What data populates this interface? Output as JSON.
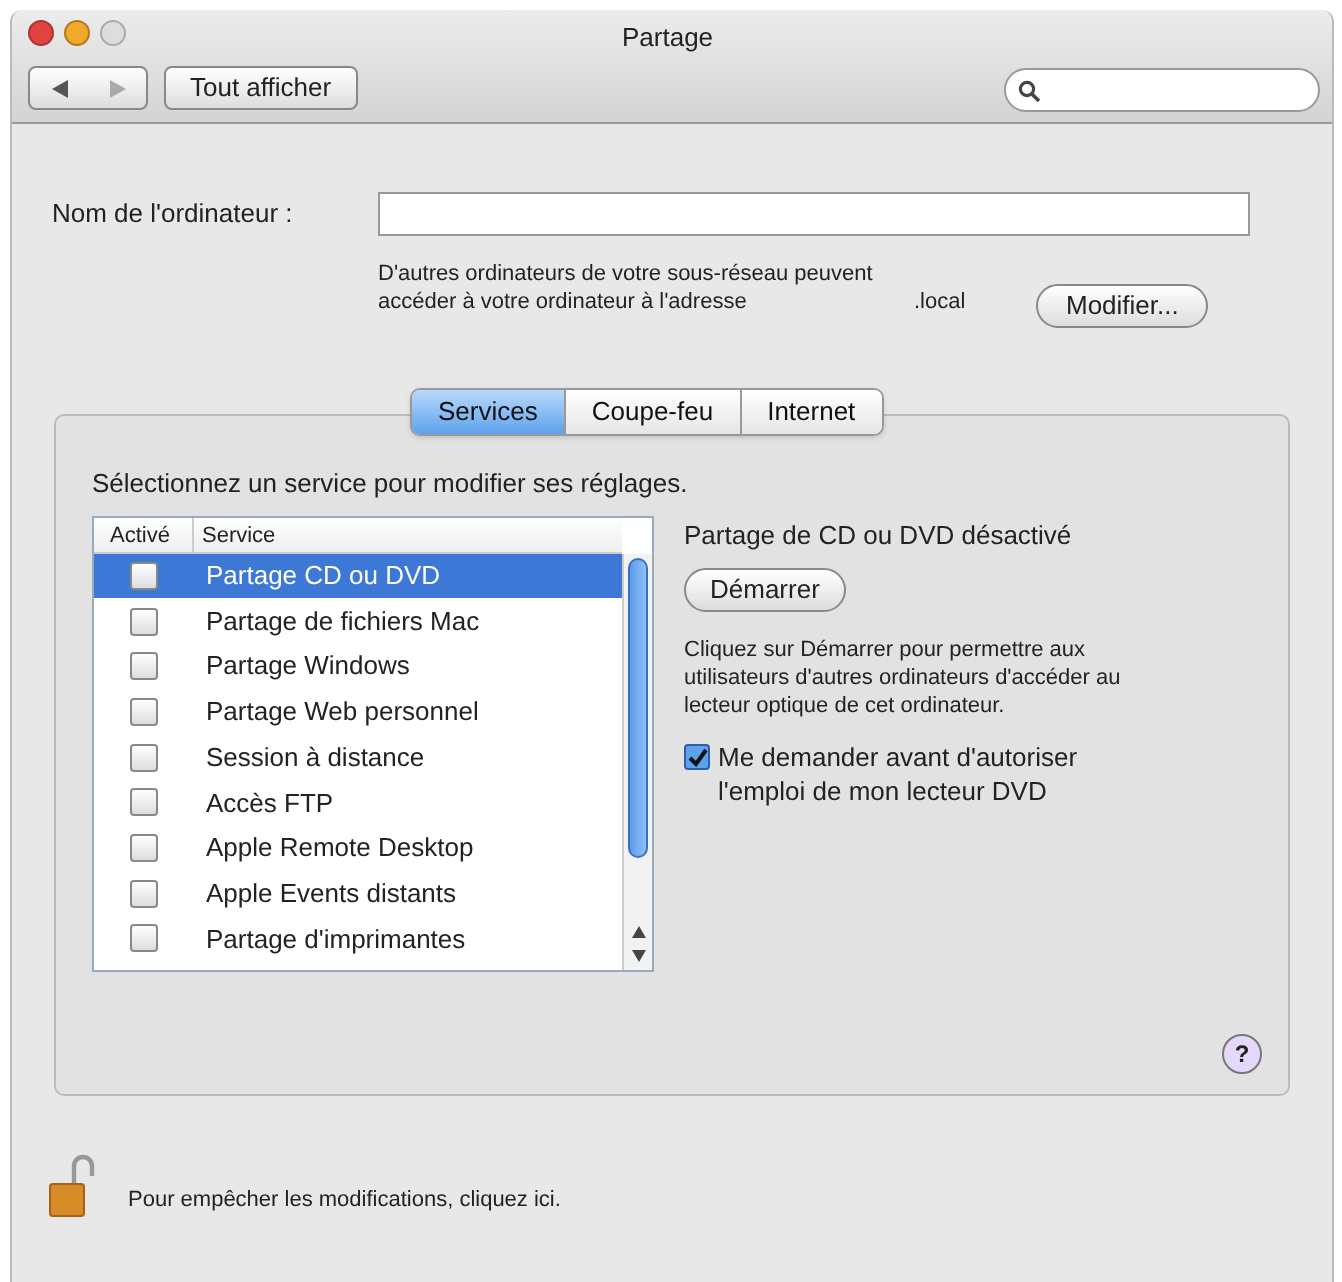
{
  "window": {
    "title": "Partage"
  },
  "toolbar": {
    "show_all": "Tout afficher"
  },
  "computer_name": {
    "label": "Nom de l'ordinateur :"
  },
  "address": {
    "lines": [
      "D'autres ordinateurs de votre sous-réseau peuvent",
      "accéder à votre ordinateur à l'adresse"
    ],
    "suffix": ".local",
    "button": "Modifier..."
  },
  "tabs": [
    {
      "label": "Services",
      "selected": true
    },
    {
      "label": "Coupe-feu",
      "selected": false
    },
    {
      "label": "Internet",
      "selected": false
    }
  ],
  "instruction": "Sélectionnez un service pour modifier ses réglages.",
  "table": {
    "columns": [
      "Activé",
      "Service"
    ],
    "rows": [
      {
        "service": "Partage CD ou DVD",
        "checked": false,
        "selected": true
      },
      {
        "service": "Partage de fichiers Mac",
        "checked": false,
        "selected": false
      },
      {
        "service": "Partage Windows",
        "checked": false,
        "selected": false
      },
      {
        "service": "Partage Web personnel",
        "checked": false,
        "selected": false
      },
      {
        "service": "Session à distance",
        "checked": false,
        "selected": false
      },
      {
        "service": "Accès FTP",
        "checked": false,
        "selected": false
      },
      {
        "service": "Apple Remote Desktop",
        "checked": false,
        "selected": false
      },
      {
        "service": "Apple Events distants",
        "checked": false,
        "selected": false
      },
      {
        "service": "Partage d'imprimantes",
        "checked": false,
        "selected": false
      }
    ]
  },
  "detail": {
    "status": "Partage de CD ou DVD désactivé",
    "button": "Démarrer",
    "description": "Cliquez sur Démarrer pour permettre aux utilisateurs d'autres ordinateurs d'accéder au lecteur optique de cet ordinateur.",
    "option": {
      "label": "Me demander avant d'autoriser l'emploi de mon lecteur DVD",
      "checked": true
    },
    "help": "?"
  },
  "lock_text": "Pour empêcher les modifications, cliquez ici."
}
